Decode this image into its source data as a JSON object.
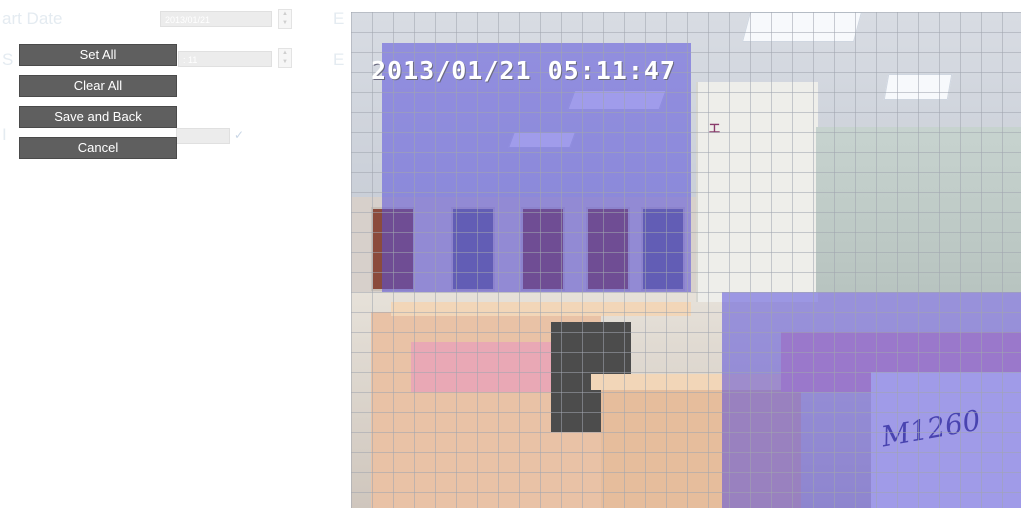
{
  "background_form": {
    "start_date_label": "art Date",
    "start_date_value": "2013/01/21",
    "end_label_1": "E",
    "end_label_2": "E",
    "time_value": ": 11",
    "row_label_1": "E",
    "row_label_2": "S",
    "row_label_3": "I"
  },
  "buttons": {
    "set_all": "Set All",
    "clear_all": "Clear All",
    "save_and_back": "Save and Back",
    "cancel": "Cancel"
  },
  "camera": {
    "timestamp": "2013/01/21 05:11:47",
    "sign_text": "工"
  },
  "colors": {
    "button_bg": "#5f5f5f",
    "overlay": "#5a50dc",
    "grid_line": "#a0a5af"
  }
}
